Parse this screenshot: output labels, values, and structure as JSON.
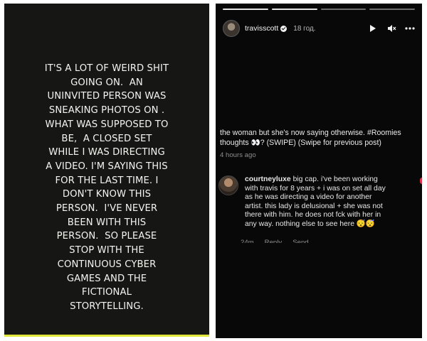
{
  "left_story": {
    "lines": [
      "IT'S A LOT OF WEIRD SHIT",
      "GOING ON.  AN",
      "UNINVITED PERSON WAS",
      "SNEAKING PHOTOS ON .",
      "WHAT WAS SUPPOSED TO",
      "BE,  A CLOSED SET",
      "WHILE I WAS DIRECTING",
      "A VIDEO. I'M SAYING THIS",
      "FOR THE LAST TIME. I",
      "DON'T KNOW THIS",
      "PERSON.  I'VE NEVER",
      "BEEN WITH THIS",
      "PERSON.  SO PLEASE",
      "STOP WITH THE",
      "CONTINUOUS CYBER",
      "GAMES AND THE",
      "FICTIONAL",
      "STORYTELLING."
    ],
    "accent_color": "#e2e63a"
  },
  "right_story": {
    "progress": {
      "segments": 4,
      "current": 2
    },
    "header": {
      "username": "travisscott",
      "verified_icon": "verified-badge-icon",
      "time": "18 год.",
      "play_icon": "play-icon",
      "mute_icon": "mute-icon",
      "more_icon": "more-icon"
    },
    "caption": {
      "line1": "the woman but she's now saying otherwise. #Roomies",
      "line2": "thoughts 👀? (SWIPE) (Swipe for previous post)",
      "time": "4 hours ago"
    },
    "comment": {
      "username": "courtneyluxe",
      "text_line1": " big cap. i've been working",
      "text_line2": "with travis for 8 years + i was on set all day",
      "text_line3": "as he was directing a video for another",
      "text_line4": "artist. this lady is delusional + she was not",
      "text_line5": "there with him. he does not fck with her in",
      "text_line6": "any way. nothing else to see here 😴😴",
      "time": "24m",
      "reply": "Reply",
      "send": "Send",
      "heart_color": "#e0354b"
    }
  }
}
